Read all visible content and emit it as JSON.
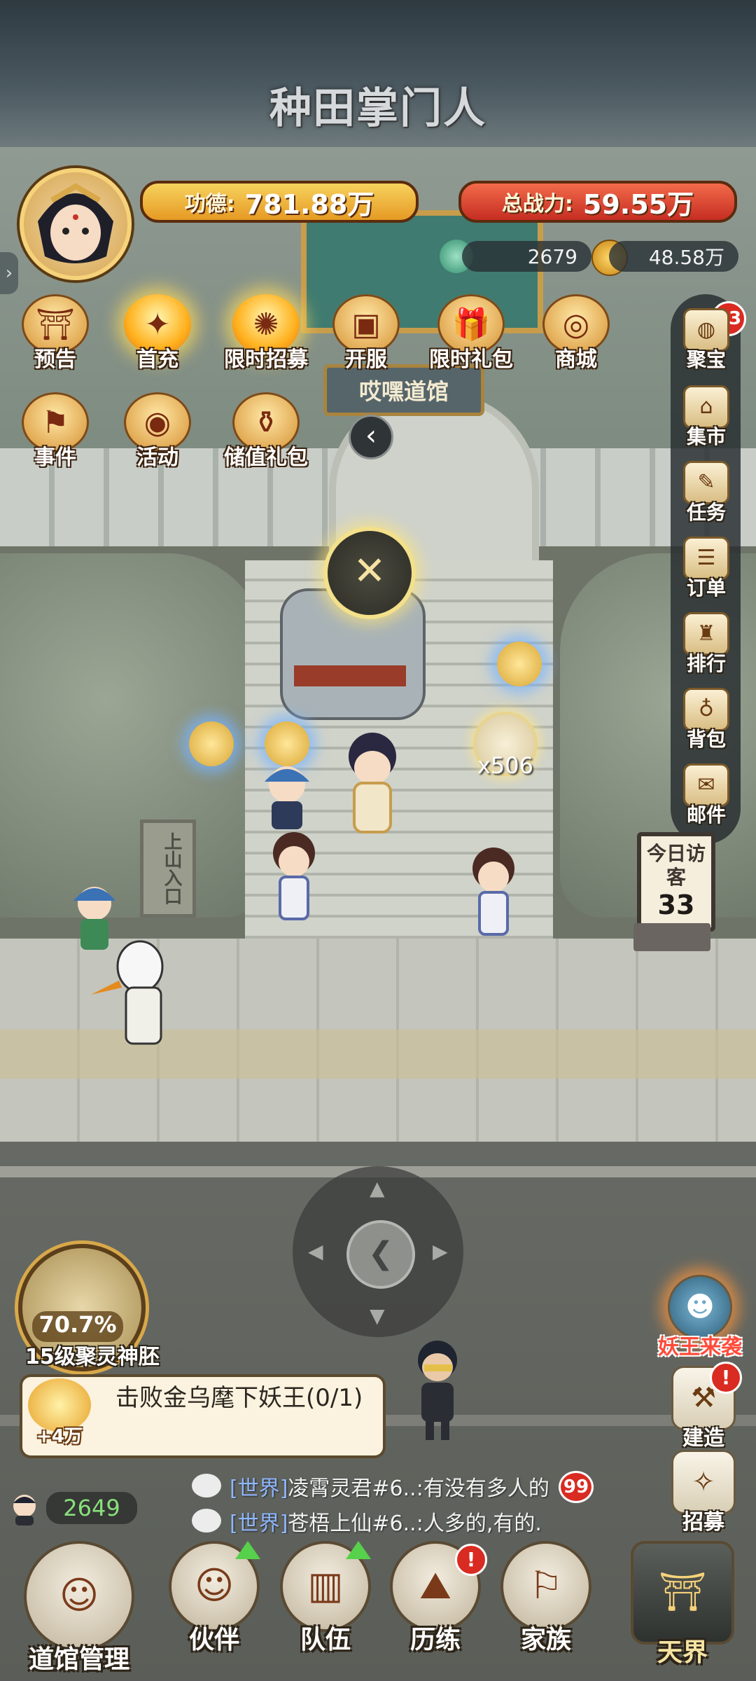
{
  "game_title": "种田掌门人",
  "player": {
    "merit_label": "功德:",
    "merit_value": "781.88万",
    "power_label": "总战力:",
    "power_value": "59.55万",
    "jade": "2679",
    "coins": "48.58万"
  },
  "top_icons_row1": [
    {
      "label": "预告",
      "icon": "gate-icon"
    },
    {
      "label": "首充",
      "icon": "flame-treasure-icon"
    },
    {
      "label": "限时招募",
      "icon": "flame-recruit-icon"
    },
    {
      "label": "开服",
      "icon": "chest-icon"
    },
    {
      "label": "限时礼包",
      "icon": "gift-icon"
    },
    {
      "label": "商城",
      "icon": "shop-coin-icon"
    }
  ],
  "top_icons_row2": [
    {
      "label": "事件",
      "icon": "dragon-flag-icon"
    },
    {
      "label": "活动",
      "icon": "drum-icon"
    },
    {
      "label": "储值礼包",
      "icon": "treasure-pot-icon"
    }
  ],
  "hall_sign": "哎嘿道馆",
  "side_menu": {
    "badge": "13",
    "items": [
      {
        "label": "聚宝",
        "icon": "treasure-bowl-icon"
      },
      {
        "label": "集市",
        "icon": "market-icon"
      },
      {
        "label": "任务",
        "icon": "scroll-icon"
      },
      {
        "label": "订单",
        "icon": "order-scroll-icon"
      },
      {
        "label": "排行",
        "icon": "ranking-pavilion-icon"
      },
      {
        "label": "背包",
        "icon": "bag-icon"
      },
      {
        "label": "邮件",
        "icon": "mail-icon"
      }
    ]
  },
  "visitor_board": {
    "label": "今日访客",
    "count": "33"
  },
  "mountain_sign": "上山入口",
  "loot": {
    "count": "x506"
  },
  "spirit": {
    "percent": "70.7%",
    "label": "15级聚灵神胚"
  },
  "quest": {
    "reward": "+4万",
    "text": "击败金乌麾下妖王(0/1)"
  },
  "chat": {
    "online": "2649",
    "badge": "99",
    "messages": [
      {
        "channel": "[世界]",
        "text": "凌霄灵君#6..:有没有多人的"
      },
      {
        "channel": "[世界]",
        "text": "苍梧上仙#6..:人多的,有的."
      }
    ]
  },
  "right_buttons": [
    {
      "label": "妖王来袭",
      "icon": "demon-king-icon"
    },
    {
      "label": "建造",
      "icon": "hammer-icon",
      "alert": "!"
    },
    {
      "label": "招募",
      "icon": "recruit-scroll-icon"
    }
  ],
  "bottom_nav": [
    {
      "label": "道馆管理",
      "icon": "crane-master-icon"
    },
    {
      "label": "伙伴",
      "icon": "partner-icon"
    },
    {
      "label": "队伍",
      "icon": "team-book-icon"
    },
    {
      "label": "历练",
      "icon": "mountain-icon",
      "alert": "!"
    },
    {
      "label": "家族",
      "icon": "clan-banner-icon"
    },
    {
      "label": "天界",
      "icon": "heaven-shrine-icon"
    }
  ],
  "colors": {
    "merit_pill": "#e59a23",
    "power_pill": "#c62d22",
    "badge_red": "#d92b21",
    "online_green": "#89e07c",
    "chat_channel": "#8fb7ff"
  }
}
